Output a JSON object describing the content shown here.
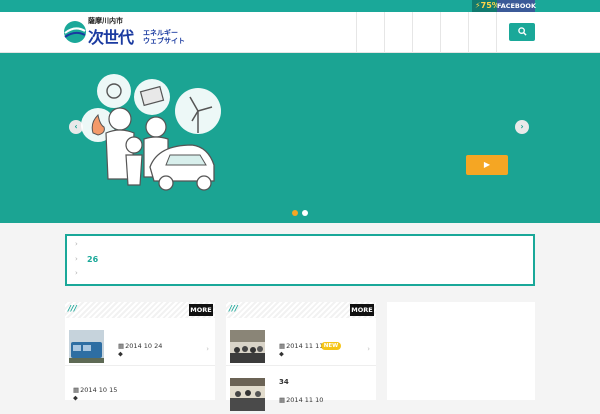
{
  "topbar": {
    "percent": "75",
    "percent_unit": "%",
    "facebook": "FACEBOOK"
  },
  "logo": {
    "top_text": "薩摩川内市",
    "main_text": "次世代",
    "sub_line1": "エネルギー",
    "sub_line2": "ウェブサイト"
  },
  "header": {
    "search_icon": "search-icon"
  },
  "hero": {
    "prev_icon": "chevron-left-icon",
    "next_icon": "chevron-right-icon",
    "play_icon": "play-icon",
    "slides": 2,
    "active_slide": 1
  },
  "news": {
    "count": "26"
  },
  "column_left": {
    "more_label": "MORE",
    "items": [
      {
        "date": "2014 10 24"
      },
      {
        "date": "2014 10 15"
      }
    ]
  },
  "column_mid": {
    "more_label": "MORE",
    "items": [
      {
        "date": "2014 11 11",
        "badge": "NEW"
      },
      {
        "title": "34",
        "date": "2014 11 10"
      }
    ]
  },
  "colors": {
    "teal": "#1aa899",
    "orange": "#f5a623",
    "facebook": "#3b5a98",
    "logo_blue": "#1a3aa0"
  }
}
